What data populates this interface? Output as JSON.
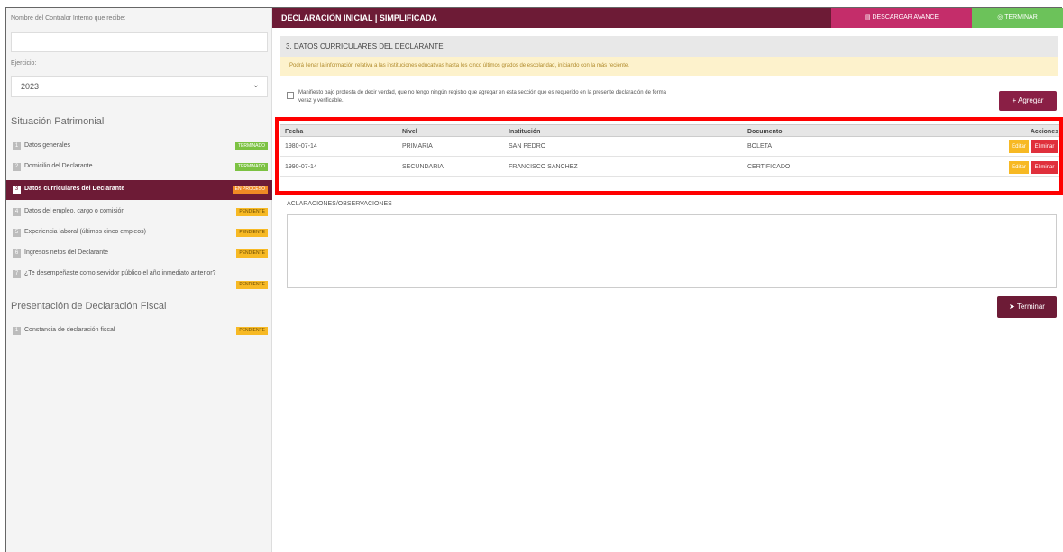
{
  "sidebar": {
    "controller_label": "Nombre del Contralor Interno que recibe:",
    "controller_value": "",
    "exercise_label": "Ejercicio:",
    "exercise_value": "2023",
    "heading_patrimonial": "Situación Patrimonial",
    "heading_fiscal": "Presentación de Declaración Fiscal",
    "items": [
      {
        "num": "1",
        "label": "Datos generales",
        "status": "TERMINADO"
      },
      {
        "num": "2",
        "label": "Domicilio del Declarante",
        "status": "TERMINADO"
      },
      {
        "num": "3",
        "label": "Datos curriculares del Declarante",
        "status": "EN PROCESO"
      },
      {
        "num": "4",
        "label": "Datos del empleo, cargo o comisión",
        "status": "PENDIENTE"
      },
      {
        "num": "5",
        "label": "Experiencia laboral (últimos cinco empleos)",
        "status": "PENDIENTE"
      },
      {
        "num": "6",
        "label": "Ingresos netos del Declarante",
        "status": "PENDIENTE"
      },
      {
        "num": "7",
        "label": "¿Te desempeñaste como servidor público el año inmediato anterior?",
        "status": "PENDIENTE"
      }
    ],
    "fiscal_items": [
      {
        "num": "1",
        "label": "Constancia de declaración fiscal",
        "status": "PENDIENTE"
      }
    ]
  },
  "topbar": {
    "title": "DECLARACIÓN INICIAL | SIMPLIFICADA",
    "download_label": "DESCARGAR AVANCE",
    "finish_label": "TERMINAR"
  },
  "section": {
    "title": "3. DATOS CURRICULARES DEL DECLARANTE",
    "notice": "Podrá llenar la información relativa a las instituciones educativas hasta los cinco últimos grados de escolaridad, iniciando con la más reciente.",
    "checkbox_text": "Manifiesto bajo protesta de decir verdad, que no tengo ningún registro que agregar en esta sección que es requerido en la presente declaración de forma veraz y verificable.",
    "add_label": "+ Agregar"
  },
  "table": {
    "headers": [
      "Fecha",
      "Nivel",
      "Institución",
      "Documento",
      "Acciones"
    ],
    "rows": [
      {
        "fecha": "1980-07-14",
        "nivel": "PRIMARIA",
        "institucion": "SAN PEDRO",
        "documento": "BOLETA"
      },
      {
        "fecha": "1990-07-14",
        "nivel": "SECUNDARIA",
        "institucion": "FRANCISCO SANCHEZ",
        "documento": "CERTIFICADO"
      }
    ],
    "edit_label": "Editar",
    "delete_label": "Eliminar"
  },
  "observations": {
    "label": "ACLARACIONES/OBSERVACIONES",
    "value": ""
  },
  "finish_button": "Terminar"
}
